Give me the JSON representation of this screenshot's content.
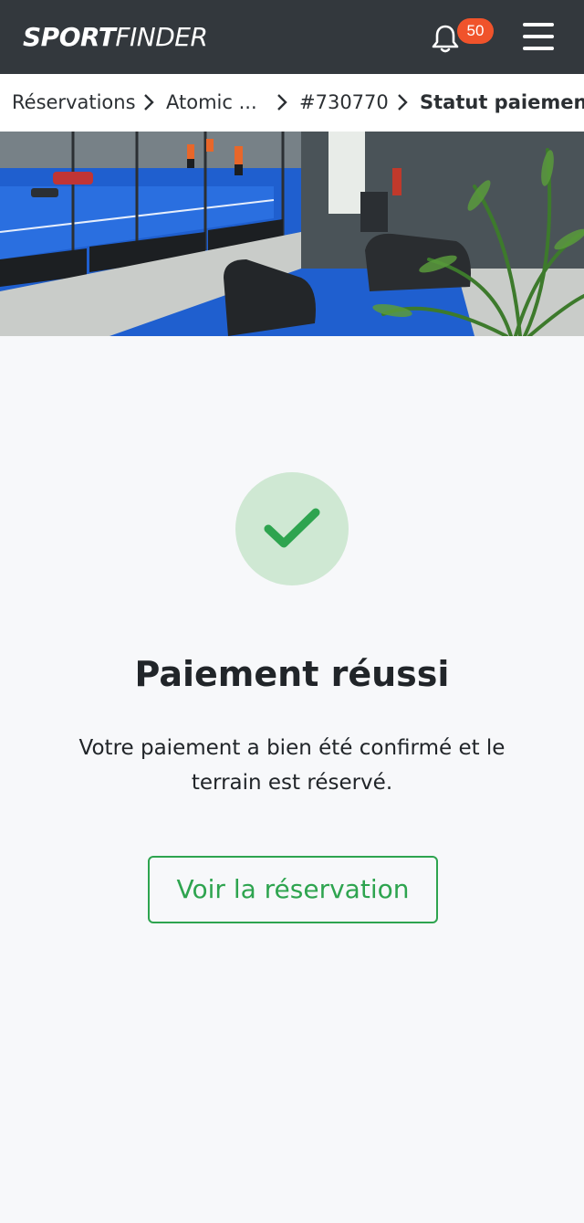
{
  "header": {
    "logo_bold": "SPORT",
    "logo_light": "FINDER",
    "notification_count": "50",
    "bell_icon": "bell-icon",
    "menu_icon": "hamburger-menu-icon"
  },
  "breadcrumb": {
    "items": [
      {
        "label": "Réservations"
      },
      {
        "label": "Atomic ..."
      },
      {
        "label": "#730770"
      },
      {
        "label": "Statut paiement"
      }
    ],
    "separator_icon": "chevron-right-icon"
  },
  "hero": {
    "description_icon": "padel-club-photo"
  },
  "status": {
    "icon": "checkmark-icon",
    "title": "Paiement réussi",
    "message": "Votre paiement a bien été confirmé et le terrain est réservé.",
    "button_label": "Voir la réservation"
  },
  "colors": {
    "header_bg": "#33383d",
    "badge": "#f0532b",
    "success": "#2ea44f",
    "success_light": "#cfe8d3",
    "page_bg": "#f7f8fa"
  }
}
